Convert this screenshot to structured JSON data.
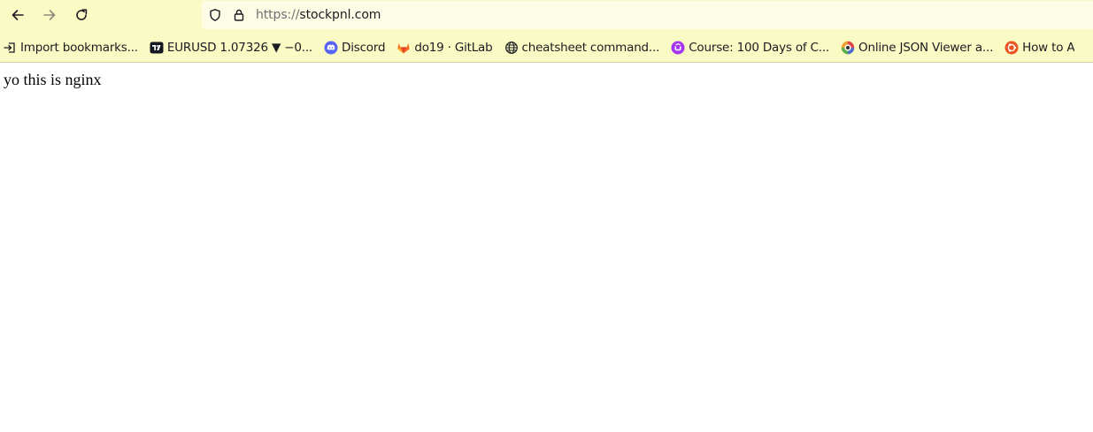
{
  "toolbar": {
    "back_icon": "arrow-left-icon",
    "forward_icon": "arrow-right-icon",
    "reload_icon": "reload-icon"
  },
  "urlbar": {
    "scheme": "https://",
    "host": "stockpnl.com",
    "shield_icon": "shield-icon",
    "lock_icon": "lock-icon"
  },
  "bookmarks": [
    {
      "label": "Import bookmarks...",
      "icon": "import-icon"
    },
    {
      "label": "EURUSD 1.07326 ▼ −0...",
      "icon": "tradingview-icon"
    },
    {
      "label": "Discord",
      "icon": "discord-icon"
    },
    {
      "label": "do19 · GitLab",
      "icon": "gitlab-icon"
    },
    {
      "label": "cheatsheet command...",
      "icon": "globe-icon"
    },
    {
      "label": "Course: 100 Days of C...",
      "icon": "udemy-icon"
    },
    {
      "label": "Online JSON Viewer a...",
      "icon": "json-viewer-icon"
    },
    {
      "label": "How to A",
      "icon": "ubuntu-icon"
    }
  ],
  "page": {
    "text": "yo this is nginx"
  },
  "colors": {
    "chrome_background": "#fafac4",
    "urlbar_background": "#fdfde6",
    "text": "#1c1b22"
  }
}
